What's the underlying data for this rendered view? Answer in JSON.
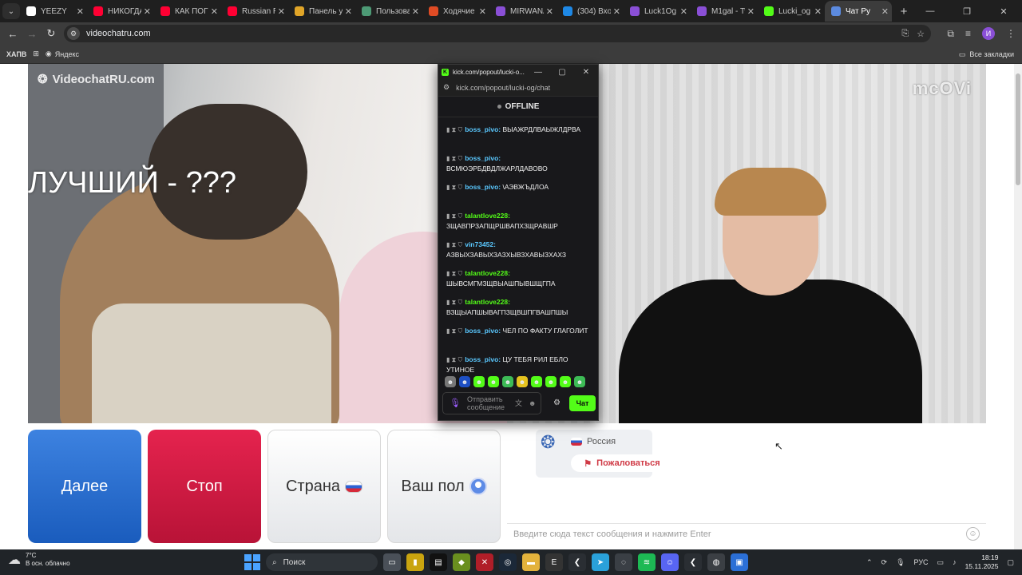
{
  "browser": {
    "tabs": [
      {
        "title": "YEEZY",
        "color": "#ffffff"
      },
      {
        "title": "НИКОГДА",
        "color": "#ff0033"
      },
      {
        "title": "КАК ПОГИ",
        "color": "#ff0033"
      },
      {
        "title": "Russian Ra",
        "color": "#ff0033"
      },
      {
        "title": "Панель уп",
        "color": "#e0a528"
      },
      {
        "title": "Пользова",
        "color": "#4d9a75"
      },
      {
        "title": "Ходячие м",
        "color": "#e04b24"
      },
      {
        "title": "MIRWANA",
        "color": "#8a4fd6"
      },
      {
        "title": "(304) Вход",
        "color": "#1e88e5"
      },
      {
        "title": "Luck1Og",
        "color": "#8a4fd6"
      },
      {
        "title": "M1gal - Tw",
        "color": "#8a4fd6"
      },
      {
        "title": "Lucki_og",
        "color": "#53fc18"
      },
      {
        "title": "Чат Ру",
        "color": "#5c8be0"
      }
    ],
    "url": "videochatru.com",
    "bookmarks": {
      "apps_label": "ХАПВ",
      "yandex_label": "Яндекс",
      "all_label": "Все закладки"
    },
    "profile_initial": "И"
  },
  "page": {
    "logo_text": "VideochatRU.com",
    "overlay_text": "ЛУЧШИЙ - ???",
    "right_watermark": "mcOVi",
    "buttons": {
      "next": "Далее",
      "stop": "Стоп",
      "country": "Страна",
      "gender": "Ваш пол"
    },
    "peer": {
      "country": "Россия",
      "report": "Пожаловаться"
    },
    "message_placeholder": "Введите сюда текст сообщения и нажмите Enter"
  },
  "kick": {
    "window_title": "kick.com/popout/lucki-o...",
    "url": "kick.com/popout/lucki-og/chat",
    "status": "OFFLINE",
    "messages": [
      {
        "user": "boss_pivo:",
        "text": "ВЫАЖРДЛВАЫЖЛДРВА",
        "color": "#5ac8ff"
      },
      {
        "user": "boss_pivo:",
        "text": "ВСМЮЭРБДВДЛЖАРЛДАВОВО",
        "color": "#5ac8ff"
      },
      {
        "user": "boss_pivo:",
        "text": "\\АЭВЖЪДЛОА",
        "color": "#5ac8ff"
      },
      {
        "user": "talantlove228:",
        "text": "ЗЩАВПРЗАПЩРШВАПХЗЩРАВШР",
        "color": "#53fc18"
      },
      {
        "user": "vin73452:",
        "text": "АЗВЫХЗАВЫХЗАЗХЫВЗХАВЫЗХАХЗ",
        "color": "#5ac8ff"
      },
      {
        "user": "talantlove228:",
        "text": "ШЫВСМГМЗЩВЫАШПЫВШЩГПА",
        "color": "#53fc18"
      },
      {
        "user": "talantlove228:",
        "text": "ВЗЩЫАПШЫВАГПЗЩВШПГВАШПШЫ",
        "color": "#53fc18"
      },
      {
        "user": "boss_pivo:",
        "text": "ЧЕЛ ПО ФАКТУ ГЛАГОЛИТ",
        "color": "#5ac8ff"
      },
      {
        "user": "boss_pivo:",
        "text": "ЦУ ТЕБЯ РИЛ ЕБЛО УТИНОЕ",
        "color": "#5ac8ff"
      }
    ],
    "input_placeholder": "Отправить сообщение",
    "send_label": "Чат"
  },
  "taskbar": {
    "weather_temp": "7°C",
    "weather_desc": "В осн. облачно",
    "search_label": "Поиск",
    "lang": "РУС",
    "time": "18:19",
    "date": "15.11.2025"
  }
}
